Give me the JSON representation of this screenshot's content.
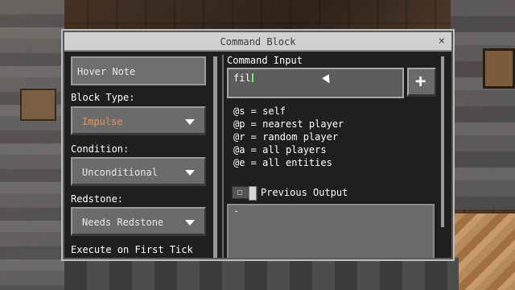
{
  "window": {
    "title": "Command Block",
    "close_glyph": "×"
  },
  "left_panel": {
    "hover_note": "Hover Note",
    "block_type_label": "Block Type:",
    "block_type_value": "Impulse",
    "condition_label": "Condition:",
    "condition_value": "Unconditional",
    "redstone_label": "Redstone:",
    "redstone_value": "Needs Redstone",
    "execute_first_tick_label": "Execute on First Tick"
  },
  "right_panel": {
    "command_input_label": "Command Input",
    "command_input_value": "fil",
    "add_button_glyph": "+",
    "selectors": [
      "@s = self",
      "@p = nearest player",
      "@r = random player",
      "@a = all players",
      "@e = all entities"
    ],
    "previous_output_label": "Previous Output",
    "previous_output_value": "-"
  },
  "colors": {
    "accent": "#e8935a",
    "caret": "#5aff5a"
  },
  "icons": {
    "close": "close-icon",
    "dropdown": "chevron-down-icon",
    "add": "plus-icon"
  }
}
